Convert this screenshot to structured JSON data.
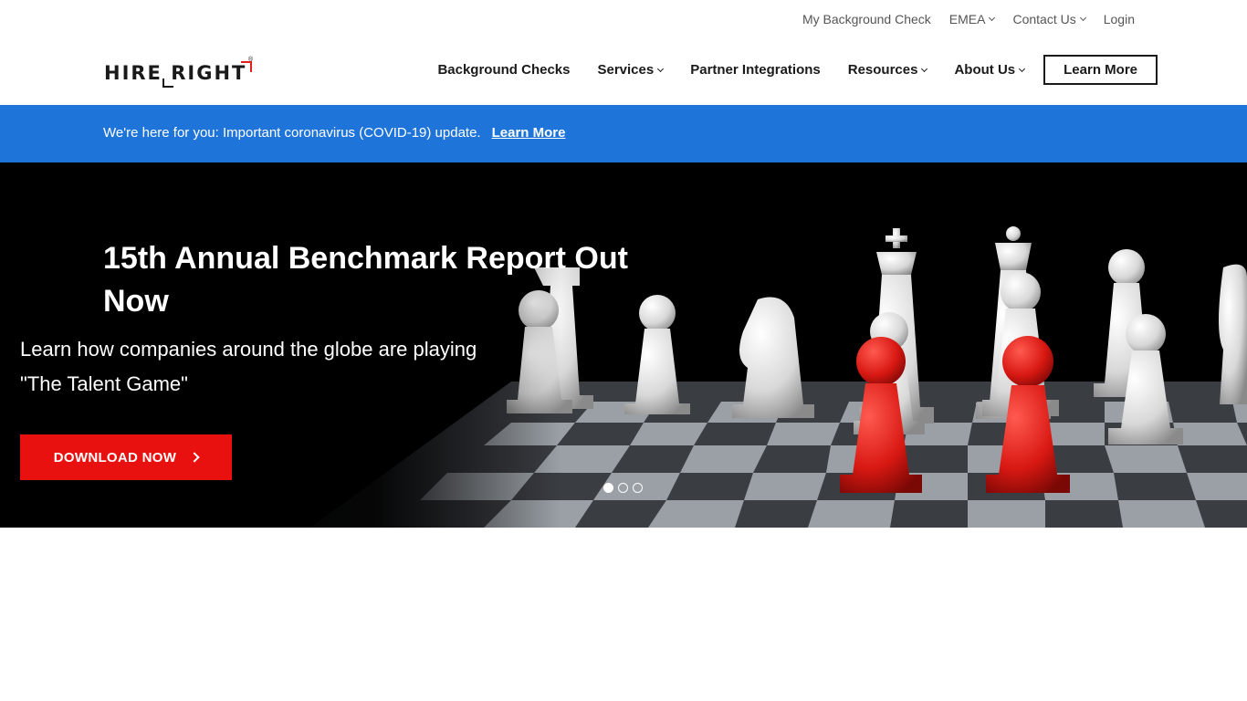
{
  "topbar": {
    "links": [
      {
        "label": "My Background Check",
        "dropdown": false
      },
      {
        "label": "EMEA",
        "dropdown": true
      },
      {
        "label": "Contact Us",
        "dropdown": true
      },
      {
        "label": "Login",
        "dropdown": false
      }
    ]
  },
  "header": {
    "logo": {
      "hire": "HIRE",
      "right": "RIGHT",
      "reg": "®"
    },
    "nav": [
      {
        "label": "Background Checks",
        "dropdown": false
      },
      {
        "label": "Services",
        "dropdown": true
      },
      {
        "label": "Partner Integrations",
        "dropdown": false
      },
      {
        "label": "Resources",
        "dropdown": true
      },
      {
        "label": "About Us",
        "dropdown": true
      }
    ],
    "cta_label": "Learn More"
  },
  "alert": {
    "message": "We're here for you: Important coronavirus (COVID-19) update.",
    "link_label": "Learn More"
  },
  "hero": {
    "title": "15th Annual Benchmark Report Out Now",
    "subtitle": "Learn how companies around the globe are playing \"The Talent Game\"",
    "button_label": "DOWNLOAD NOW",
    "slides": [
      {
        "active": true
      },
      {
        "active": false
      },
      {
        "active": false
      }
    ]
  },
  "colors": {
    "alert_bg": "#1f74d9",
    "cta_red": "#e8110f",
    "hero_bg": "#000000"
  }
}
